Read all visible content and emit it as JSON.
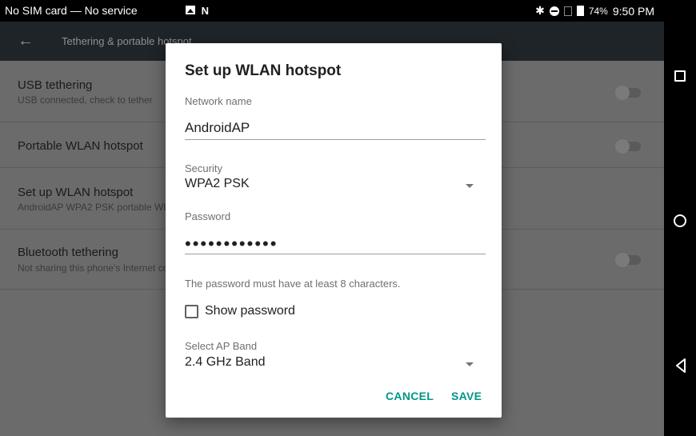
{
  "status_bar": {
    "carrier": "No SIM card — No service",
    "battery_percent": "74%",
    "time": "9:50 PM",
    "bluetooth_glyph": "✱",
    "notification_glyph": "N"
  },
  "toolbar": {
    "back_glyph": "←",
    "title": "Tethering & portable hotspot"
  },
  "settings": {
    "rows": [
      {
        "title": "USB tethering",
        "subtitle": "USB connected, check to tether"
      },
      {
        "title": "Portable WLAN hotspot",
        "subtitle": ""
      },
      {
        "title": "Set up WLAN hotspot",
        "subtitle": "AndroidAP WPA2 PSK portable WLAN hotspot"
      },
      {
        "title": "Bluetooth tethering",
        "subtitle": "Not sharing this phone's Internet connection"
      }
    ]
  },
  "dialog": {
    "title": "Set up WLAN hotspot",
    "network_name_label": "Network name",
    "network_name_value": "AndroidAP",
    "security_label": "Security",
    "security_value": "WPA2 PSK",
    "password_label": "Password",
    "password_value": "••••••••••••",
    "password_hint": "The password must have at least 8 characters.",
    "show_password_label": "Show password",
    "show_password_checked": false,
    "ap_band_label": "Select AP Band",
    "ap_band_value": "2.4 GHz Band",
    "cancel_label": "CANCEL",
    "save_label": "SAVE"
  },
  "colors": {
    "accent": "#009688",
    "toolbar_bg": "#1e2428",
    "scrim": "#6b6b6b"
  }
}
